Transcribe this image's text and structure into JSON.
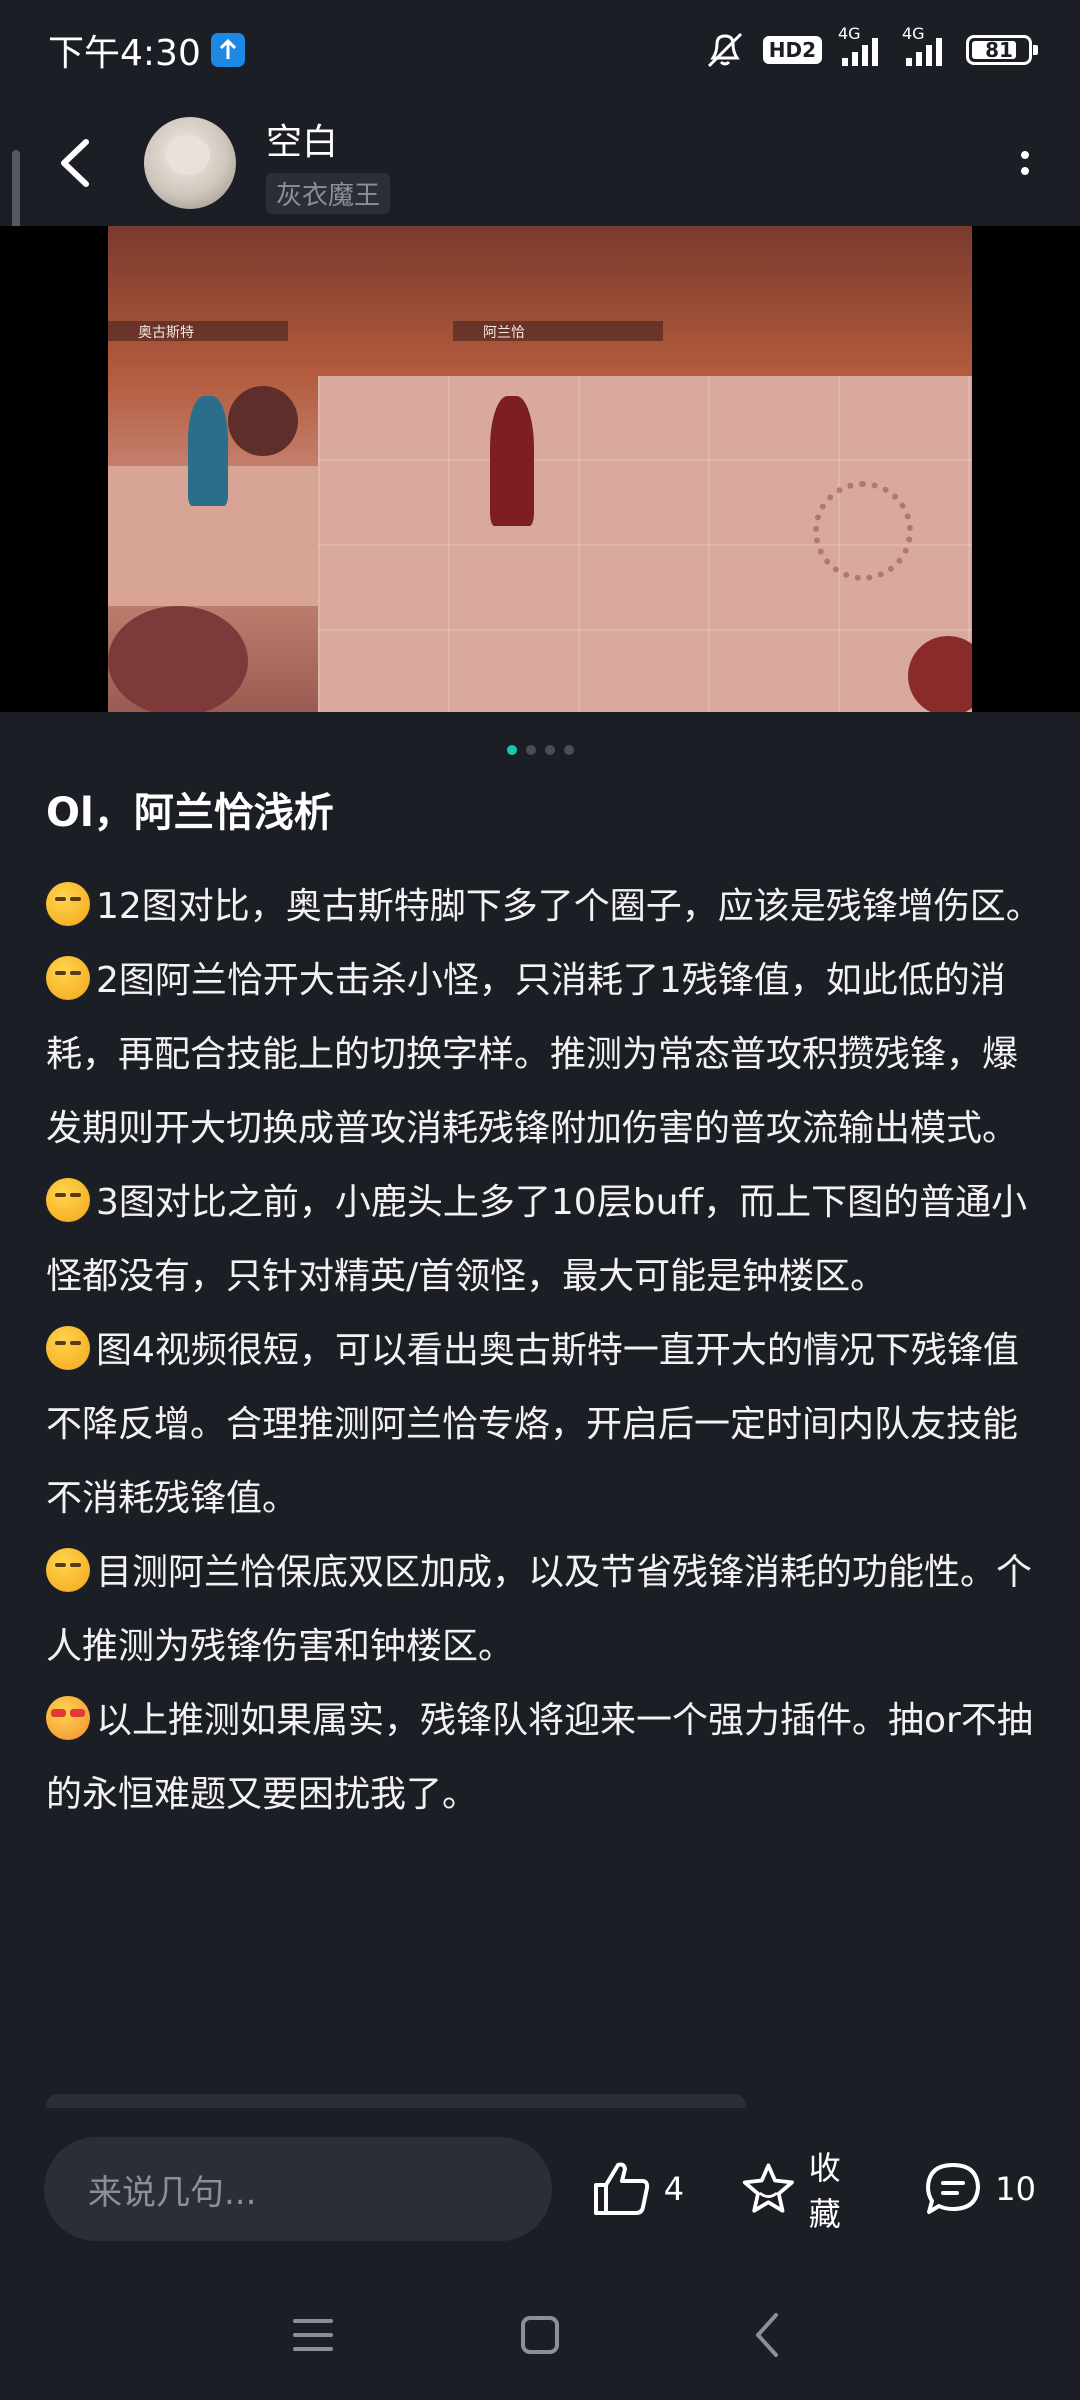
{
  "status_bar": {
    "time": "下午4:30",
    "hd_label": "HD2",
    "network_1": "4G",
    "network_2": "4G",
    "battery": "81",
    "battery_level": 0.81
  },
  "header": {
    "username": "空白",
    "user_tag": "灰衣魔王"
  },
  "media": {
    "label_left": "奥古斯特",
    "label_center": "阿兰恰",
    "pages": 4,
    "active_page": 1
  },
  "post": {
    "title": "Ol，阿兰恰浅析",
    "paragraphs": [
      {
        "emoji": "thinking-face",
        "text": "12图对比，奥古斯特脚下多了个圈子，应该是残锋增伤区。"
      },
      {
        "emoji": "thinking-face",
        "text": "2图阿兰恰开大击杀小怪，只消耗了1残锋值，如此低的消耗，再配合技能上的切换字样。推测为常态普攻积攒残锋，爆发期则开大切换成普攻消耗残锋附加伤害的普攻流输出模式。"
      },
      {
        "emoji": "thinking-face",
        "text": "3图对比之前，小鹿头上多了10层buff，而上下图的普通小怪都没有，只针对精英/首领怪，最大可能是钟楼区。"
      },
      {
        "emoji": "thinking-face",
        "text": "图4视频很短，可以看出奥古斯特一直开大的情况下残锋值不降反增。合理推测阿兰恰专烙，开启后一定时间内队友技能不消耗残锋值。"
      },
      {
        "emoji": "thinking-face",
        "text": "目测阿兰恰保底双区加成，以及节省残锋消耗的功能性。个人推测为残锋伤害和钟楼区。"
      },
      {
        "emoji": "sunglasses-face",
        "text": "以上推测如果属实，残锋队将迎来一个强力插件。抽or不抽的永恒难题又要困扰我了。"
      }
    ]
  },
  "action_bar": {
    "comment_placeholder": "来说几句...",
    "like_count": "4",
    "favorite_label": "收藏",
    "comment_count": "10"
  }
}
